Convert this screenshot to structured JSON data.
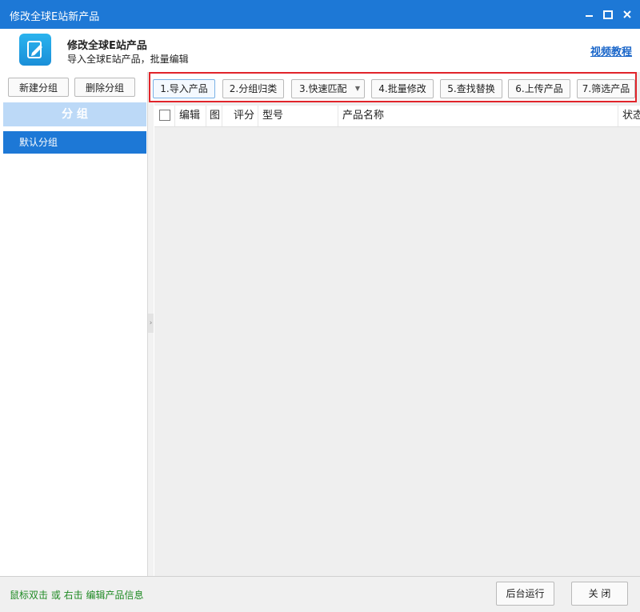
{
  "window": {
    "title": "修改全球E站新产品"
  },
  "header": {
    "title": "修改全球E站产品",
    "subtitle": "导入全球E站产品，批量编辑",
    "video_link": "视频教程",
    "app_icon": "edit-document-icon"
  },
  "sidebar": {
    "new_group": "新建分组",
    "delete_group": "删除分组",
    "group_header": "分  组",
    "groups": [
      "默认分组"
    ]
  },
  "toolbar": {
    "buttons": [
      "1.导入产品",
      "2.分组归类",
      "3.快速匹配",
      "4.批量修改",
      "5.查找替换",
      "6.上传产品",
      "7.筛选产品"
    ]
  },
  "grid": {
    "columns": [
      "编辑",
      "图",
      "评分",
      "型号",
      "产品名称",
      "状态"
    ]
  },
  "footer": {
    "hint": "鼠标双击 或 右击 编辑产品信息",
    "run_background": "后台运行",
    "close": "关 闭"
  },
  "colors": {
    "accent": "#1d78d6",
    "highlight_border": "#e1242a",
    "hint_text": "#1f8a24"
  }
}
